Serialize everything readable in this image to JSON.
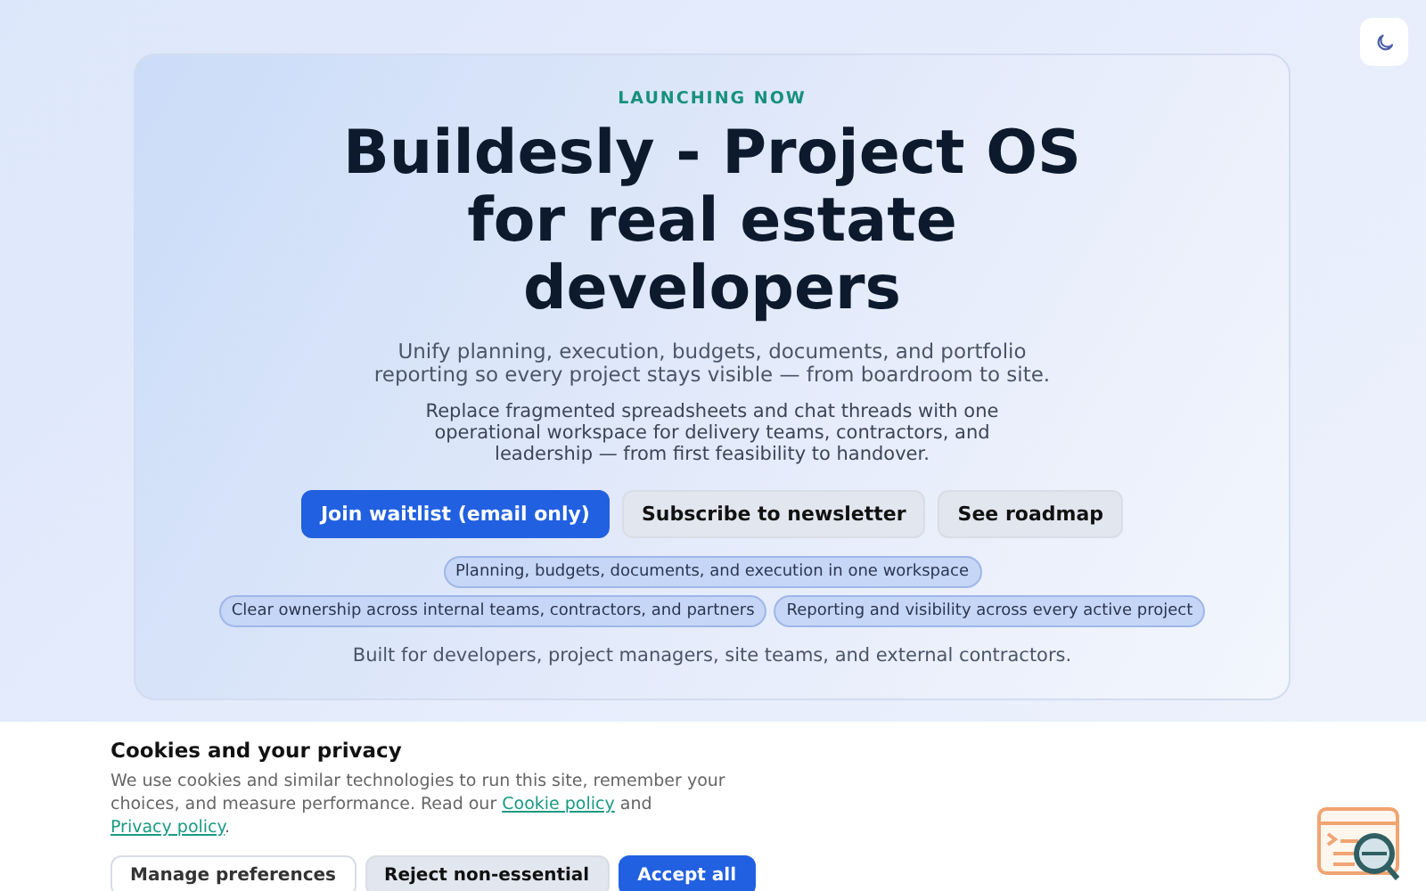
{
  "hero": {
    "eyebrow": "LAUNCHING NOW",
    "title": "Buildesly - Project OS for real estate developers",
    "lead": "Unify planning, execution, budgets, documents, and portfolio reporting so every project stays visible — from boardroom to site.",
    "body": "Replace fragmented spreadsheets and chat threads with one operational workspace for delivery teams, contractors, and leadership — from first feasibility to handover.",
    "buttons": [
      {
        "label": "Join waitlist (email only)",
        "kind": "primary"
      },
      {
        "label": "Subscribe to newsletter",
        "kind": "secondary"
      },
      {
        "label": "See roadmap",
        "kind": "secondary"
      }
    ],
    "tags": [
      "Planning, budgets, documents, and execution in one workspace",
      "Clear ownership across internal teams, contractors, and partners",
      "Reporting and visibility across every active project"
    ],
    "audience": "Built for developers, project managers, site teams, and external contractors."
  },
  "cookie_banner": {
    "title": "Cookies and your privacy",
    "text_before": "We use cookies and similar technologies to run this site, remember your choices, and measure performance. Read our",
    "link_1": "Cookie policy",
    "text_between": "and",
    "link_2": "Privacy policy",
    "text_after": ".",
    "buttons": [
      {
        "label": "Manage preferences",
        "kind": "outline"
      },
      {
        "label": "Reject non-essential",
        "kind": "secondary"
      },
      {
        "label": "Accept all",
        "kind": "primary"
      }
    ]
  }
}
